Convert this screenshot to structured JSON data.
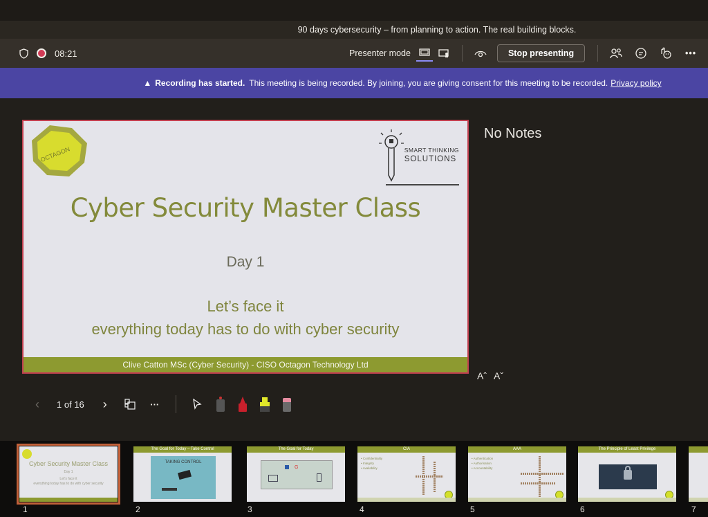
{
  "window": {
    "title": "90 days cybersecurity – from planning to action. The real building blocks."
  },
  "toolbar": {
    "timer": "08:21",
    "presenter_mode_label": "Presenter mode",
    "stop_presenting_label": "Stop presenting",
    "icons": [
      "shield-icon",
      "record-icon",
      "standard-view-icon",
      "presenter-view-icon",
      "eye-icon",
      "people-icon",
      "chat-icon",
      "reactions-icon",
      "more-icon"
    ]
  },
  "banner": {
    "icon": "warning-icon",
    "bold": "Recording has started.",
    "text": "This meeting is being recorded. By joining, you are giving consent for this meeting to be recorded.",
    "link": "Privacy policy",
    "color": "#4b45a3"
  },
  "slide": {
    "logo_left_text": "OCTAGON",
    "logo_right_line1": "SMART THINKING",
    "logo_right_line2": "SOLUTIONS",
    "title": "Cyber Security Master Class",
    "day": "Day 1",
    "subtitle_line1": "Let’s face it",
    "subtitle_line2": "everything today has to do with cyber security",
    "footer": "Clive Catton MSc (Cyber Security) - CISO Octagon Technology Ltd",
    "accent_color": "#8d9a30"
  },
  "notes": {
    "text": "No Notes",
    "increase_font_label": "Aˆ",
    "decrease_font_label": "Aˇ"
  },
  "navigation": {
    "counter": "1 of 16",
    "current_slide": 1,
    "total_slides": 16
  },
  "thumbnails": [
    {
      "number": "1",
      "title": "Cyber Security Master Class",
      "day": "Day 1",
      "sub1": "Let's face it",
      "sub2": "everything today has to do with cyber security",
      "selected": true
    },
    {
      "number": "2",
      "title": "The Goal for Today – Take Control",
      "image_text": "TAKING CONTROL"
    },
    {
      "number": "3",
      "title": "The Goal for Today"
    },
    {
      "number": "4",
      "title": "CIA",
      "bullets": [
        "Confidentiality",
        "Integrity",
        "Availability"
      ]
    },
    {
      "number": "5",
      "title": "AAA",
      "bullets": [
        "Authentication",
        "Authorisation",
        "Accountability"
      ]
    },
    {
      "number": "6",
      "title": "The Principle of Least Privilege"
    },
    {
      "number": "7",
      "title": ""
    }
  ]
}
